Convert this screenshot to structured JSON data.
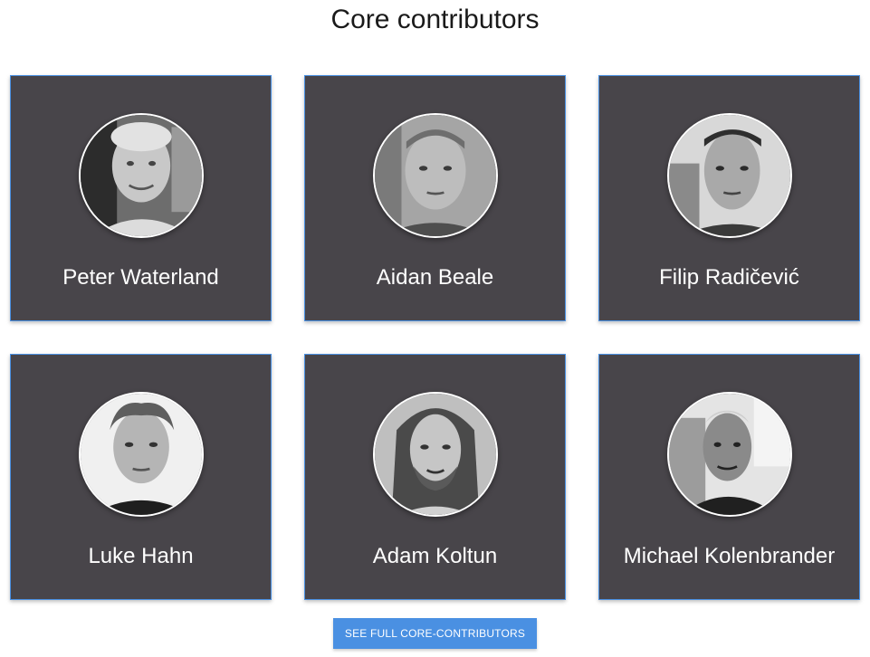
{
  "page": {
    "title": "Core contributors"
  },
  "contributors": [
    {
      "name": "Peter Waterland",
      "avatar_icon": "portrait-photo"
    },
    {
      "name": "Aidan Beale",
      "avatar_icon": "portrait-photo"
    },
    {
      "name": "Filip Radičević",
      "avatar_icon": "portrait-photo"
    },
    {
      "name": "Luke Hahn",
      "avatar_icon": "portrait-photo"
    },
    {
      "name": "Adam Koltun",
      "avatar_icon": "portrait-photo"
    },
    {
      "name": "Michael Kolenbrander",
      "avatar_icon": "portrait-photo"
    }
  ],
  "cta": {
    "label": "SEE FULL CORE-CONTRIBUTORS"
  },
  "colors": {
    "card_background": "#48454a",
    "card_border": "#4a90e2",
    "button_background": "#4a90e2",
    "text_on_card": "#ffffff"
  }
}
